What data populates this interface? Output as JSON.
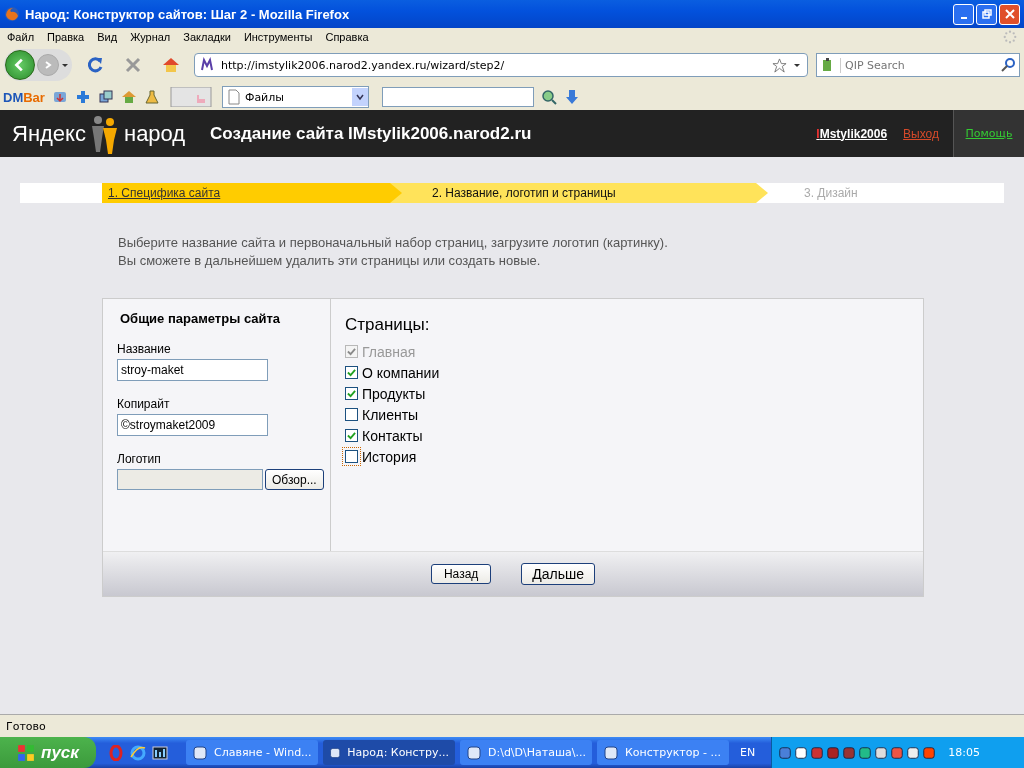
{
  "window": {
    "title": "Народ: Конструктор сайтов: Шаг 2 - Mozilla Firefox"
  },
  "menu": [
    "Файл",
    "Правка",
    "Вид",
    "Журнал",
    "Закладки",
    "Инструменты",
    "Справка"
  ],
  "address": {
    "value": "http://imstylik2006.narod2.yandex.ru/wizard/step2/"
  },
  "search": {
    "placeholder": "QIP Search"
  },
  "dmbar": {
    "logo_dm": "DM",
    "logo_bar": "Bar",
    "dropdown": "Файлы"
  },
  "header": {
    "logo_left": "Яндекс",
    "logo_right": "народ",
    "title": "Создание сайта IMstylik2006.narod2.ru",
    "user": "IMstylik2006",
    "logout": "Выход",
    "help": "Помощь"
  },
  "steps": [
    {
      "label": "1. Специфика сайта",
      "kind": "done"
    },
    {
      "label": "2. Название, логотип и страницы",
      "kind": "current"
    },
    {
      "label": "3. Дизайн",
      "kind": "pending"
    }
  ],
  "intro": [
    "Выберите название сайта и первоначальный набор страниц, загрузите логотип (картинку).",
    "Вы сможете в дальнейшем удалить эти страницы или создать новые."
  ],
  "params": {
    "heading": "Общие параметры сайта",
    "fields": [
      {
        "label": "Название",
        "value": "stroy-maket"
      },
      {
        "label": "Копирайт",
        "value": "©stroymaket2009"
      }
    ],
    "logo_label": "Логотип",
    "browse": "Обзор..."
  },
  "pages": {
    "heading": "Страницы:",
    "items": [
      {
        "label": "Главная",
        "checked": true,
        "disabled": true,
        "focused": false
      },
      {
        "label": "О компании",
        "checked": true,
        "disabled": false,
        "focused": false
      },
      {
        "label": "Продукты",
        "checked": true,
        "disabled": false,
        "focused": false
      },
      {
        "label": "Клиенты",
        "checked": false,
        "disabled": false,
        "focused": false
      },
      {
        "label": "Контакты",
        "checked": true,
        "disabled": false,
        "focused": false
      },
      {
        "label": "История",
        "checked": false,
        "disabled": false,
        "focused": true
      }
    ]
  },
  "buttons": {
    "back": "Назад",
    "next": "Дальше"
  },
  "status_bar": "Готово",
  "taskbar": {
    "start": "пуск",
    "tasks": [
      {
        "label": "Славяне - Wind...",
        "selected": false
      },
      {
        "label": "Народ: Констру...",
        "selected": true
      },
      {
        "label": "D:\\d\\D\\Наташа\\...",
        "selected": false
      },
      {
        "label": "Конструктор - ...",
        "selected": false
      }
    ],
    "lang": "EN",
    "clock": "18:05"
  }
}
